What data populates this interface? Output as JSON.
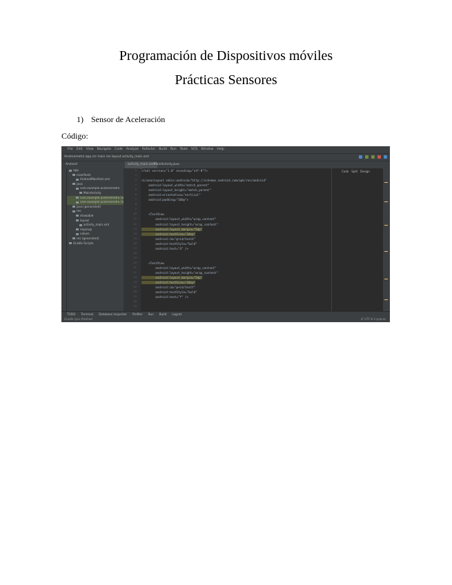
{
  "document": {
    "title_line1": "Programación de Dispositivos móviles",
    "title_line2": "Prácticas Sensores",
    "list_item_number": "1)",
    "list_item_text": "Sensor de Aceleración",
    "code_label": "Código:"
  },
  "ide": {
    "menu": [
      "File",
      "Edit",
      "View",
      "Navigate",
      "Code",
      "Analyze",
      "Refactor",
      "Build",
      "Run",
      "Tools",
      "VCS",
      "Window",
      "Help"
    ],
    "breadcrumb": "Acelerometro  app  src  main  res  layout  activity_main.xml",
    "editor_tab": "activity_main.xml",
    "editor_tab2": "MainActivity.java",
    "project_label": "Android",
    "view_tabs": [
      "Code",
      "Split",
      "Design"
    ],
    "tree": [
      {
        "label": "app",
        "state": ""
      },
      {
        "label": "manifests",
        "state": ""
      },
      {
        "label": "AndroidManifest.xml",
        "state": ""
      },
      {
        "label": "java",
        "state": ""
      },
      {
        "label": "com.example.acelerometro",
        "state": ""
      },
      {
        "label": "MainActivity",
        "state": ""
      },
      {
        "label": "com.example.acelerometro (androidTest)",
        "state": "hl"
      },
      {
        "label": "com.example.acelerometro (test)",
        "state": "hl"
      },
      {
        "label": "java (generated)",
        "state": ""
      },
      {
        "label": "res",
        "state": ""
      },
      {
        "label": "drawable",
        "state": ""
      },
      {
        "label": "layout",
        "state": ""
      },
      {
        "label": "activity_main.xml",
        "state": ""
      },
      {
        "label": "mipmap",
        "state": ""
      },
      {
        "label": "values",
        "state": ""
      },
      {
        "label": "res (generated)",
        "state": ""
      },
      {
        "label": "Gradle Scripts",
        "state": ""
      }
    ],
    "line_numbers": [
      "1",
      "2",
      "3",
      "4",
      "5",
      "6",
      "7",
      "8",
      "9",
      "10",
      "11",
      "12",
      "13",
      "14",
      "15",
      "16",
      "17",
      "18",
      "19",
      "20",
      "21",
      "22",
      "23",
      "24",
      "25",
      "26",
      "27",
      "28",
      "29"
    ],
    "code_lines": [
      {
        "text": "<?xml version=\"1.0\" encoding=\"utf-8\"?>",
        "hl": false
      },
      {
        "text": "",
        "hl": false
      },
      {
        "text": "<LinearLayout xmlns:android=\"http://schemas.android.com/apk/res/android\"",
        "hl": false
      },
      {
        "text": "    android:layout_width=\"match_parent\"",
        "hl": false
      },
      {
        "text": "    android:layout_height=\"match_parent\"",
        "hl": false
      },
      {
        "text": "    android:orientation=\"vertical\"",
        "hl": false
      },
      {
        "text": "    android:padding=\"10dp\">",
        "hl": false
      },
      {
        "text": "",
        "hl": false
      },
      {
        "text": "",
        "hl": false
      },
      {
        "text": "    <TextView",
        "hl": false
      },
      {
        "text": "        android:layout_width=\"wrap_content\"",
        "hl": false
      },
      {
        "text": "        android:layout_height=\"wrap_content\"",
        "hl": false
      },
      {
        "text": "        android:layout_margin=\"5dp\"",
        "hl": true
      },
      {
        "text": "        android:textSize=\"20sp\"",
        "hl": true
      },
      {
        "text": "        android:id=\"@+id/textX\"",
        "hl": false
      },
      {
        "text": "        android:textStyle=\"bold\"",
        "hl": false
      },
      {
        "text": "        android:text=\"X\" />",
        "hl": false
      },
      {
        "text": "",
        "hl": false
      },
      {
        "text": "",
        "hl": false
      },
      {
        "text": "    <TextView",
        "hl": false
      },
      {
        "text": "        android:layout_width=\"wrap_content\"",
        "hl": false
      },
      {
        "text": "        android:layout_height=\"wrap_content\"",
        "hl": false
      },
      {
        "text": "        android:layout_margin=\"5dp\"",
        "hl": true
      },
      {
        "text": "        android:textSize=\"20sp\"",
        "hl": true
      },
      {
        "text": "        android:id=\"@+id/textY\"",
        "hl": false
      },
      {
        "text": "        android:textStyle=\"bold\"",
        "hl": false
      },
      {
        "text": "        android:text=\"Y\" />",
        "hl": false
      },
      {
        "text": "",
        "hl": false
      },
      {
        "text": "",
        "hl": false
      }
    ],
    "bottom_tools": [
      "TODO",
      "Terminal",
      "Database Inspector",
      "Profiler",
      "Run",
      "Build",
      "Logcat"
    ],
    "status_left": "Gradle sync finished",
    "status_right": "LF  UTF-8  4 spaces"
  }
}
